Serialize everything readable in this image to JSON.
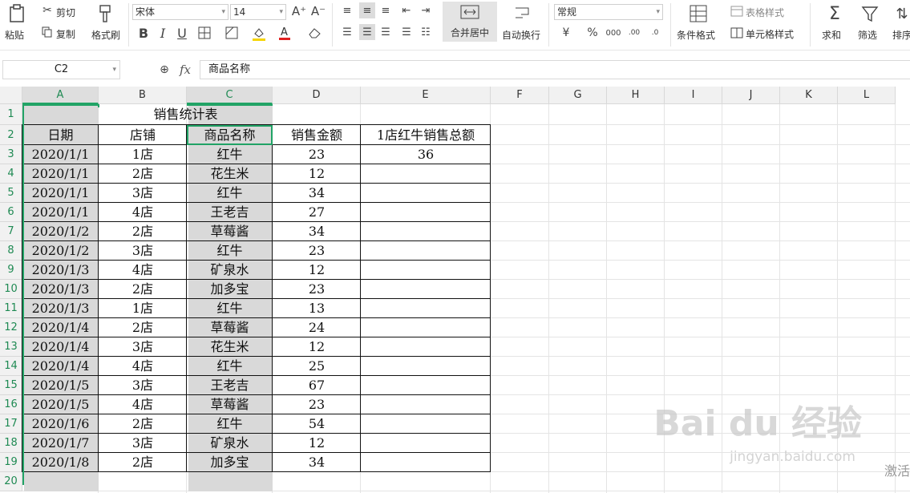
{
  "ribbon": {
    "paste": "粘贴",
    "cut": "剪切",
    "copy": "复制",
    "format_painter": "格式刷",
    "font_name": "宋体",
    "font_size": "14",
    "bold": "B",
    "italic": "I",
    "underline": "U",
    "merge_center": "合并居中",
    "wrap_text": "自动换行",
    "number_format": "常规",
    "currency": "¥",
    "percent": "%",
    "conditional_format": "条件格式",
    "table_style": "表格样式",
    "cell_style": "单元格样式",
    "sum": "求和",
    "filter": "筛选",
    "sort": "排序"
  },
  "formula_bar": {
    "cell_ref": "C2",
    "fx": "fx",
    "content": "商品名称"
  },
  "columns": [
    "A",
    "B",
    "C",
    "D",
    "E",
    "F",
    "G",
    "H",
    "I",
    "J",
    "K",
    "L"
  ],
  "rows": [
    "1",
    "2",
    "3",
    "4",
    "5",
    "6",
    "7",
    "8",
    "9",
    "10",
    "11",
    "12",
    "13",
    "14",
    "15",
    "16",
    "17",
    "18",
    "19",
    "20"
  ],
  "sheet": {
    "title": "销售统计表",
    "headers": [
      "日期",
      "店铺",
      "商品名称",
      "销售金额",
      "1店红牛销售总额"
    ],
    "data": [
      [
        "2020/1/1",
        "1店",
        "红牛",
        "23",
        "36"
      ],
      [
        "2020/1/1",
        "2店",
        "花生米",
        "12",
        ""
      ],
      [
        "2020/1/1",
        "3店",
        "红牛",
        "34",
        ""
      ],
      [
        "2020/1/1",
        "4店",
        "王老吉",
        "27",
        ""
      ],
      [
        "2020/1/2",
        "2店",
        "草莓酱",
        "34",
        ""
      ],
      [
        "2020/1/2",
        "3店",
        "红牛",
        "23",
        ""
      ],
      [
        "2020/1/3",
        "4店",
        "矿泉水",
        "12",
        ""
      ],
      [
        "2020/1/3",
        "2店",
        "加多宝",
        "23",
        ""
      ],
      [
        "2020/1/3",
        "1店",
        "红牛",
        "13",
        ""
      ],
      [
        "2020/1/4",
        "2店",
        "草莓酱",
        "24",
        ""
      ],
      [
        "2020/1/4",
        "3店",
        "花生米",
        "12",
        ""
      ],
      [
        "2020/1/4",
        "4店",
        "红牛",
        "25",
        ""
      ],
      [
        "2020/1/5",
        "3店",
        "王老吉",
        "67",
        ""
      ],
      [
        "2020/1/5",
        "4店",
        "草莓酱",
        "23",
        ""
      ],
      [
        "2020/1/6",
        "2店",
        "红牛",
        "54",
        ""
      ],
      [
        "2020/1/7",
        "3店",
        "矿泉水",
        "12",
        ""
      ],
      [
        "2020/1/8",
        "2店",
        "加多宝",
        "34",
        ""
      ]
    ]
  },
  "watermark": {
    "brand": "Bai du 经验",
    "url": "jingyan.baidu.com"
  },
  "activate_text": "激活"
}
